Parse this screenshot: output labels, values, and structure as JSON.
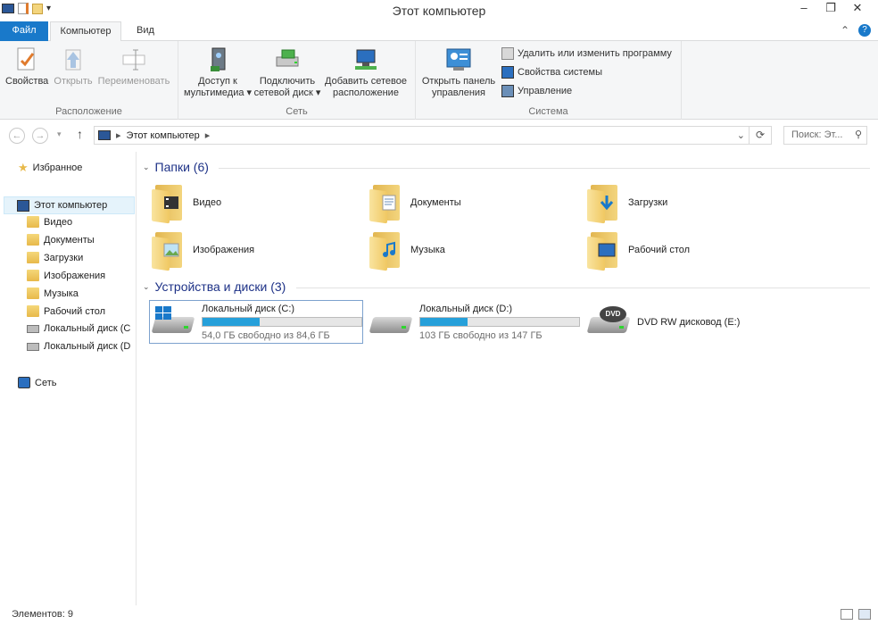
{
  "window": {
    "title": "Этот компьютер"
  },
  "ribbon_tabs": {
    "file": "Файл",
    "computer": "Компьютер",
    "view": "Вид"
  },
  "ribbon": {
    "location": {
      "label": "Расположение",
      "properties": "Свойства",
      "open": "Открыть",
      "rename": "Переименовать"
    },
    "network": {
      "label": "Сеть",
      "media_l1": "Доступ к",
      "media_l2": "мультимедиа",
      "map_l1": "Подключить",
      "map_l2": "сетевой диск",
      "add_l1": "Добавить сетевое",
      "add_l2": "расположение"
    },
    "system": {
      "label": "Система",
      "panel_l1": "Открыть панель",
      "panel_l2": "управления",
      "uninstall": "Удалить или изменить программу",
      "sysprops": "Свойства системы",
      "manage": "Управление"
    }
  },
  "address": {
    "path": "Этот компьютер",
    "search_placeholder": "Поиск: Эт..."
  },
  "nav": {
    "favorites": "Избранное",
    "this_pc": "Этот компьютер",
    "items": [
      "Видео",
      "Документы",
      "Загрузки",
      "Изображения",
      "Музыка",
      "Рабочий стол",
      "Локальный диск (C",
      "Локальный диск (D"
    ],
    "network": "Сеть"
  },
  "folders": {
    "header": "Папки (6)",
    "items": [
      "Видео",
      "Документы",
      "Загрузки",
      "Изображения",
      "Музыка",
      "Рабочий стол"
    ]
  },
  "devices": {
    "header": "Устройства и диски (3)",
    "drives": [
      {
        "name": "Локальный диск (C:)",
        "free": "54,0 ГБ свободно из 84,6 ГБ",
        "used_fraction": 0.36
      },
      {
        "name": "Локальный диск (D:)",
        "free": "103 ГБ свободно из 147 ГБ",
        "used_fraction": 0.3
      },
      {
        "name": "DVD RW дисковод (E:)",
        "badge": "DVD"
      }
    ]
  },
  "status": {
    "items": "Элементов: 9"
  },
  "colors": {
    "accent": "#1979ca",
    "bar_fill": "#26a0da",
    "section_text": "#1e3287"
  }
}
